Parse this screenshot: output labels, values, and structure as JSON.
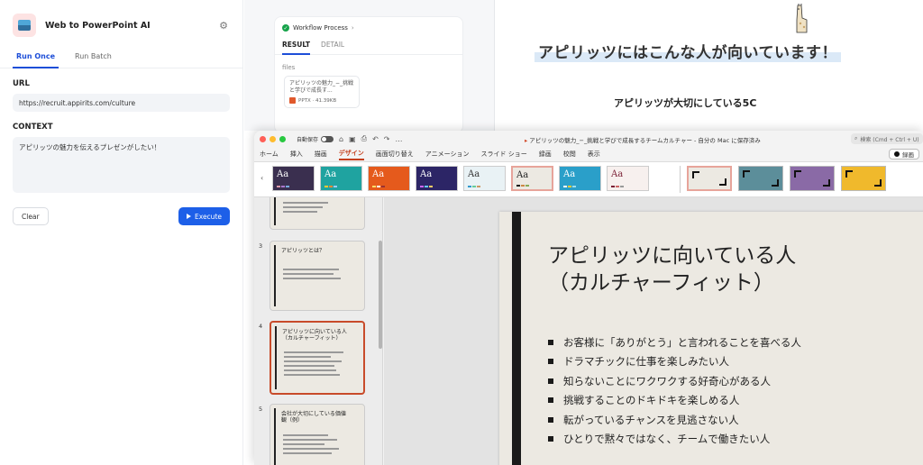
{
  "app": {
    "title": "Web to PowerPoint AI",
    "tabs": [
      {
        "label": "Run Once"
      },
      {
        "label": "Run Batch"
      }
    ],
    "url_label": "URL",
    "url_value": "https://recruit.appirits.com/culture",
    "context_label": "CONTEXT",
    "context_value": "アピリッツの魅力を伝えるプレゼンがしたい！",
    "clear_label": "Clear",
    "execute_label": "Execute"
  },
  "workflow": {
    "title": "Workflow Process",
    "tabs": [
      {
        "label": "RESULT"
      },
      {
        "label": "DETAIL"
      }
    ],
    "files_label": "files",
    "file_name": "アピリッツの魅力_−_挑戦と学びで成長す...",
    "file_meta": "PPTX · 41.39KB"
  },
  "background_slide": {
    "heading": "アピリッツにはこんな人が向いています！",
    "subheading": "アピリッツが大切にしている5C"
  },
  "powerpoint": {
    "autosave_label": "自動保存",
    "doc_title": "アピリッツの魅力_−_挑戦と学びで成長するチームカルチャー - 自分の Mac に保存済み",
    "search_placeholder": "検索 (Cmd + Ctrl + U)",
    "ribbon_tabs": [
      "ホーム",
      "挿入",
      "描画",
      "デザイン",
      "画面切り替え",
      "アニメーション",
      "スライド ショー",
      "録画",
      "校閲",
      "表示"
    ],
    "active_ribbon_tab": "デザイン",
    "record_label": "録画",
    "theme_label": "Aa",
    "thumbnails": [
      {
        "num": "3",
        "title": "アピリッツとは？"
      },
      {
        "num": "4",
        "title": "アピリッツに向いている人\n（カルチャーフィット）"
      },
      {
        "num": "5",
        "title": "会社が大切にしている価値\n観（例）"
      }
    ],
    "slide": {
      "title_line1": "アピリッツに向いている人",
      "title_line2": "（カルチャーフィット）",
      "bullets": [
        "お客様に「ありがとう」と言われることを喜べる人",
        "ドラマチックに仕事を楽しみたい人",
        "知らないことにワクワクする好奇心がある人",
        "挑戦することのドキドキを楽しめる人",
        "転がっているチャンスを見逃さない人",
        "ひとりで黙々ではなく、チームで働きたい人"
      ]
    }
  },
  "colors": {
    "accent_blue": "#1d5fe8",
    "ppt_accent": "#c43e1c",
    "slide_bg": "#ece9e2"
  }
}
